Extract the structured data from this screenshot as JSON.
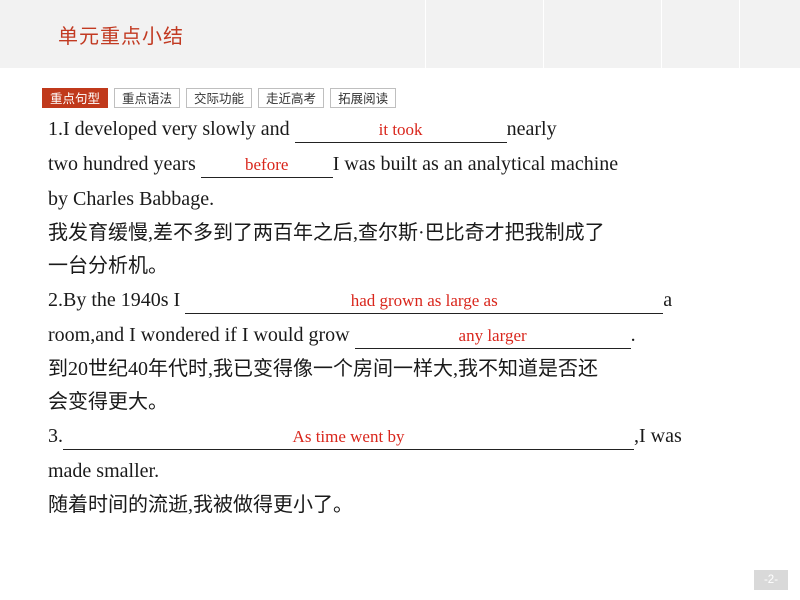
{
  "header": {
    "title": "单元重点小结"
  },
  "tabs": [
    {
      "label": "重点句型",
      "active": true
    },
    {
      "label": "重点语法",
      "active": false
    },
    {
      "label": "交际功能",
      "active": false
    },
    {
      "label": "走近高考",
      "active": false
    },
    {
      "label": "拓展阅读",
      "active": false
    }
  ],
  "items": [
    {
      "en_pre": "1.I developed very slowly and",
      "blank1": "it took",
      "en_mid1": "nearly",
      "line2_pre": "two hundred years",
      "blank2": "before",
      "line2_post": "I was built as an analytical machine",
      "line3": "by Charles Babbage.",
      "cn1": "我发育缓慢,差不多到了两百年之后,查尔斯·巴比奇才把我制成了",
      "cn2": "一台分析机。"
    },
    {
      "en_pre": "2.By the 1940s I",
      "blank1": "had grown  as large  as",
      "en_post": "a",
      "line2_pre": "room,and I wondered if I would grow",
      "blank2": "any larger",
      "line2_post": ".",
      "cn1": "到20世纪40年代时,我已变得像一个房间一样大,我不知道是否还",
      "cn2": "会变得更大。"
    },
    {
      "en_pre": "3.",
      "blank1": "As time went by",
      "en_post": ",I was",
      "line2": "made smaller.",
      "cn1": "随着时间的流逝,我被做得更小了。"
    }
  ],
  "footer": {
    "page": "-2-"
  },
  "colors": {
    "accent": "#c0391b",
    "answer": "#d9261c",
    "header_bg": "#f2f2f2",
    "title": "#c23a22"
  }
}
